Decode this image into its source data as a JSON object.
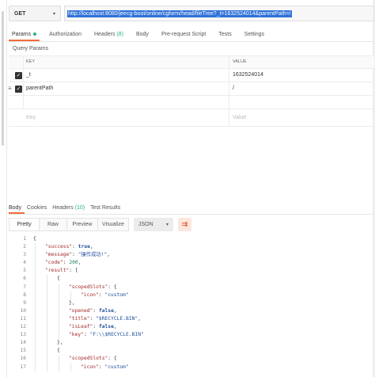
{
  "request": {
    "method": "GET",
    "url": "http://localhost:8080/jeecg-boot/online/cgform/head/fileTree?_t=1632524014&parentPath=/"
  },
  "request_tabs": [
    {
      "label": "Params",
      "active": true,
      "dot": true
    },
    {
      "label": "Authorization"
    },
    {
      "label": "Headers",
      "count": "(8)"
    },
    {
      "label": "Body"
    },
    {
      "label": "Pre-request Script"
    },
    {
      "label": "Tests"
    },
    {
      "label": "Settings"
    }
  ],
  "query_params": {
    "title": "Query Params",
    "headers": {
      "key": "KEY",
      "value": "VALUE"
    },
    "rows": [
      {
        "key": "_t",
        "value": "1632524014",
        "checked": true
      },
      {
        "key": "parentPath",
        "value": "/",
        "checked": true
      }
    ],
    "placeholder": {
      "key": "Key",
      "value": "Value"
    }
  },
  "response_tabs": [
    {
      "label": "Body",
      "active": true
    },
    {
      "label": "Cookies"
    },
    {
      "label": "Headers",
      "count": "(10)"
    },
    {
      "label": "Test Results"
    }
  ],
  "view_modes": [
    "Pretty",
    "Raw",
    "Preview",
    "Visualize"
  ],
  "active_view": "Pretty",
  "format": "JSON",
  "code_lines": [
    {
      "n": "1",
      "indent": 0,
      "tokens": [
        {
          "t": "{",
          "c": "p"
        }
      ]
    },
    {
      "n": "2",
      "indent": 1,
      "tokens": [
        {
          "t": "\"success\"",
          "c": "k"
        },
        {
          "t": ": ",
          "c": "p"
        },
        {
          "t": "true",
          "c": "b"
        },
        {
          "t": ",",
          "c": "p"
        }
      ]
    },
    {
      "n": "3",
      "indent": 1,
      "tokens": [
        {
          "t": "\"message\"",
          "c": "k"
        },
        {
          "t": ": ",
          "c": "p"
        },
        {
          "t": "\"操作成功!\"",
          "c": "s"
        },
        {
          "t": ",",
          "c": "p"
        }
      ]
    },
    {
      "n": "4",
      "indent": 1,
      "tokens": [
        {
          "t": "\"code\"",
          "c": "k"
        },
        {
          "t": ": ",
          "c": "p"
        },
        {
          "t": "200",
          "c": "n"
        },
        {
          "t": ",",
          "c": "p"
        }
      ]
    },
    {
      "n": "5",
      "indent": 1,
      "tokens": [
        {
          "t": "\"result\"",
          "c": "k"
        },
        {
          "t": ": [",
          "c": "p"
        }
      ]
    },
    {
      "n": "6",
      "indent": 2,
      "tokens": [
        {
          "t": "{",
          "c": "p"
        }
      ]
    },
    {
      "n": "7",
      "indent": 3,
      "tokens": [
        {
          "t": "\"scopedSlots\"",
          "c": "k"
        },
        {
          "t": ": {",
          "c": "p"
        }
      ]
    },
    {
      "n": "8",
      "indent": 4,
      "tokens": [
        {
          "t": "\"icon\"",
          "c": "k"
        },
        {
          "t": ": ",
          "c": "p"
        },
        {
          "t": "\"custom\"",
          "c": "s"
        }
      ]
    },
    {
      "n": "9",
      "indent": 3,
      "tokens": [
        {
          "t": "},",
          "c": "p"
        }
      ]
    },
    {
      "n": "10",
      "indent": 3,
      "tokens": [
        {
          "t": "\"opened\"",
          "c": "k"
        },
        {
          "t": ": ",
          "c": "p"
        },
        {
          "t": "false",
          "c": "b"
        },
        {
          "t": ",",
          "c": "p"
        }
      ]
    },
    {
      "n": "11",
      "indent": 3,
      "tokens": [
        {
          "t": "\"title\"",
          "c": "k"
        },
        {
          "t": ": ",
          "c": "p"
        },
        {
          "t": "\"$RECYCLE.BIN\"",
          "c": "s"
        },
        {
          "t": ",",
          "c": "p"
        }
      ]
    },
    {
      "n": "12",
      "indent": 3,
      "tokens": [
        {
          "t": "\"isLeaf\"",
          "c": "k"
        },
        {
          "t": ": ",
          "c": "p"
        },
        {
          "t": "false",
          "c": "b"
        },
        {
          "t": ",",
          "c": "p"
        }
      ]
    },
    {
      "n": "13",
      "indent": 3,
      "tokens": [
        {
          "t": "\"key\"",
          "c": "k"
        },
        {
          "t": ": ",
          "c": "p"
        },
        {
          "t": "\"F:\\\\$RECYCLE.BIN\"",
          "c": "s"
        }
      ]
    },
    {
      "n": "14",
      "indent": 2,
      "tokens": [
        {
          "t": "},",
          "c": "p"
        }
      ]
    },
    {
      "n": "15",
      "indent": 2,
      "tokens": [
        {
          "t": "{",
          "c": "p"
        }
      ]
    },
    {
      "n": "16",
      "indent": 3,
      "tokens": [
        {
          "t": "\"scopedSlots\"",
          "c": "k"
        },
        {
          "t": ": {",
          "c": "p"
        }
      ]
    },
    {
      "n": "17",
      "indent": 4,
      "tokens": [
        {
          "t": "\"icon\"",
          "c": "k"
        },
        {
          "t": ": ",
          "c": "p"
        },
        {
          "t": "\"custom\"",
          "c": "s"
        }
      ]
    }
  ],
  "colors": {
    "accent": "#f26b3a",
    "url_highlight": "#2f72d8",
    "status_green": "#26b47f"
  },
  "icons": {
    "wrap": "wrap-lines-icon",
    "check": "checkbox-checked-icon",
    "drag": "drag-handle-icon",
    "dropdown": "chevron-down-icon"
  }
}
